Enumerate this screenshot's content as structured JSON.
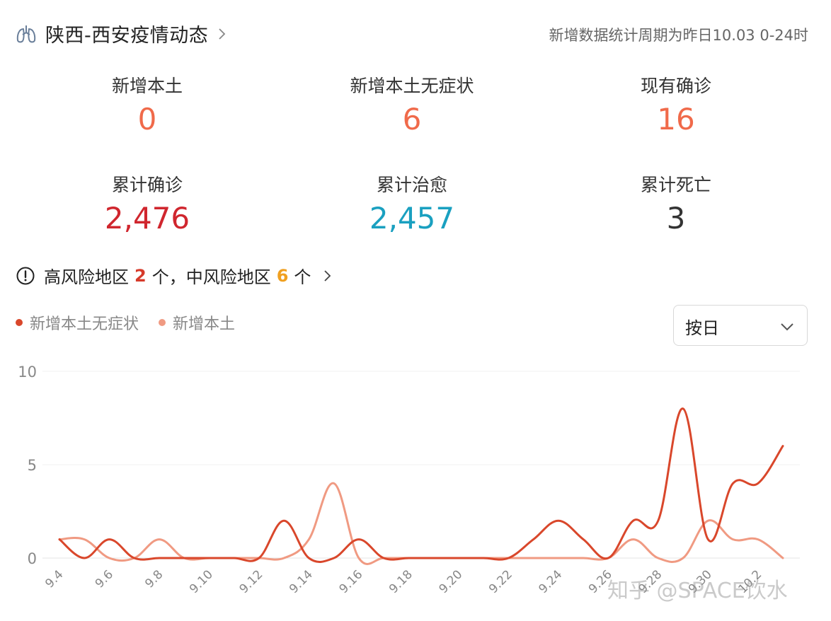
{
  "header": {
    "title": "陕西-西安疫情动态",
    "note": "新增数据统计周期为昨日10.03 0-24时"
  },
  "stats": [
    {
      "label": "新增本土",
      "value": "0",
      "color": "#f06a4a"
    },
    {
      "label": "新增本土无症状",
      "value": "6",
      "color": "#f06a4a"
    },
    {
      "label": "现有确诊",
      "value": "16",
      "color": "#f06a4a"
    },
    {
      "label": "累计确诊",
      "value": "2,476",
      "color": "#d0262e"
    },
    {
      "label": "累计治愈",
      "value": "2,457",
      "color": "#1aa0c0"
    },
    {
      "label": "累计死亡",
      "value": "3",
      "color": "#333333"
    }
  ],
  "risk": {
    "high_label": "高风险地区",
    "high_count": "2",
    "unit1": "个，",
    "mid_label": "中风险地区",
    "mid_count": "6",
    "unit2": "个"
  },
  "period_select": {
    "value": "按日"
  },
  "watermark": "知乎 @SPACE饮水",
  "chart_data": {
    "type": "line",
    "x": [
      "9.4",
      "9.5",
      "9.6",
      "9.7",
      "9.8",
      "9.9",
      "9.10",
      "9.11",
      "9.12",
      "9.13",
      "9.14",
      "9.15",
      "9.16",
      "9.17",
      "9.18",
      "9.19",
      "9.20",
      "9.21",
      "9.22",
      "9.23",
      "9.24",
      "9.25",
      "9.26",
      "9.27",
      "9.28",
      "9.29",
      "9.30",
      "10.1",
      "10.2",
      "10.3"
    ],
    "x_tick_labels": [
      "9.4",
      "9.6",
      "9.8",
      "9.10",
      "9.12",
      "9.14",
      "9.16",
      "9.18",
      "9.20",
      "9.22",
      "9.24",
      "9.26",
      "9.28",
      "9.30",
      "10.2"
    ],
    "series": [
      {
        "name": "新增本土无症状",
        "color": "#d9472b",
        "values": [
          1,
          0,
          1,
          0,
          0,
          0,
          0,
          0,
          0,
          2,
          0,
          0,
          1,
          0,
          0,
          0,
          0,
          0,
          0,
          1,
          2,
          1,
          0,
          2,
          2,
          8,
          1,
          4,
          4,
          6
        ]
      },
      {
        "name": "新增本土",
        "color": "#f09a82",
        "values": [
          1,
          1,
          0,
          0,
          1,
          0,
          0,
          0,
          0,
          0,
          1,
          4,
          0,
          0,
          0,
          0,
          0,
          0,
          0,
          0,
          0,
          0,
          0,
          1,
          0,
          0,
          2,
          1,
          1,
          0
        ]
      }
    ],
    "yticks": [
      0,
      5,
      10
    ],
    "ylim": [
      0,
      10
    ],
    "grid": true,
    "legend": "top-left"
  }
}
